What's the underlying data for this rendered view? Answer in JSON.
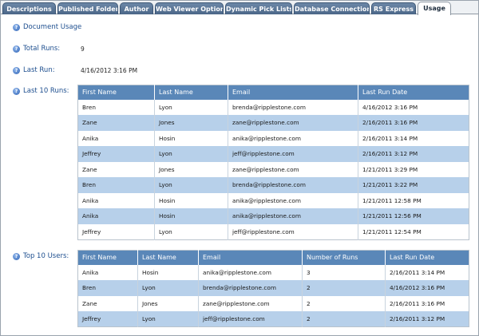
{
  "tabs": [
    {
      "label": "Descriptions",
      "active": false
    },
    {
      "label": "Published Folder",
      "active": false
    },
    {
      "label": "Author",
      "active": false
    },
    {
      "label": "Web Viewer Options",
      "active": false
    },
    {
      "label": "Dynamic Pick Lists",
      "active": false
    },
    {
      "label": "Database Connection",
      "active": false
    },
    {
      "label": "RS Express",
      "active": false
    },
    {
      "label": "Usage",
      "active": true
    }
  ],
  "sections": {
    "document_usage": "Document Usage",
    "total_runs_label": "Total Runs:",
    "total_runs_value": "9",
    "last_run_label": "Last Run:",
    "last_run_value": "4/16/2012 3:16 PM",
    "last_10_runs_label": "Last 10 Runs:",
    "top_10_users_label": "Top 10 Users:"
  },
  "last_runs": {
    "headers": [
      "First Name",
      "Last Name",
      "Email",
      "Last Run Date"
    ],
    "rows": [
      [
        "Bren",
        "Lyon",
        "brenda@ripplestone.com",
        "4/16/2012 3:16 PM"
      ],
      [
        "Zane",
        "Jones",
        "zane@ripplestone.com",
        "2/16/2011 3:16 PM"
      ],
      [
        "Anika",
        "Hosin",
        "anika@ripplestone.com",
        "2/16/2011 3:14 PM"
      ],
      [
        "Jeffrey",
        "Lyon",
        "jeff@ripplestone.com",
        "2/16/2011 3:12 PM"
      ],
      [
        "Zane",
        "Jones",
        "zane@ripplestone.com",
        "1/21/2011 3:29 PM"
      ],
      [
        "Bren",
        "Lyon",
        "brenda@ripplestone.com",
        "1/21/2011 3:22 PM"
      ],
      [
        "Anika",
        "Hosin",
        "anika@ripplestone.com",
        "1/21/2011 12:58 PM"
      ],
      [
        "Anika",
        "Hosin",
        "anika@ripplestone.com",
        "1/21/2011 12:56 PM"
      ],
      [
        "Jeffrey",
        "Lyon",
        "jeff@ripplestone.com",
        "1/21/2011 12:54 PM"
      ]
    ]
  },
  "top_users": {
    "headers": [
      "First Name",
      "Last Name",
      "Email",
      "Number of Runs",
      "Last Run Date"
    ],
    "rows": [
      [
        "Anika",
        "Hosin",
        "anika@ripplestone.com",
        "3",
        "2/16/2011 3:14 PM"
      ],
      [
        "Bren",
        "Lyon",
        "brenda@ripplestone.com",
        "2",
        "4/16/2012 3:16 PM"
      ],
      [
        "Zane",
        "Jones",
        "zane@ripplestone.com",
        "2",
        "2/16/2011 3:16 PM"
      ],
      [
        "Jeffrey",
        "Lyon",
        "jeff@ripplestone.com",
        "2",
        "2/16/2011 3:12 PM"
      ]
    ]
  },
  "icons": {
    "help": "help-icon"
  },
  "colors": {
    "tab_bg": "#4b6788",
    "header_bg": "#5a87b8",
    "alt_row": "#b7d0ea",
    "label_text": "#1e4f8f"
  }
}
